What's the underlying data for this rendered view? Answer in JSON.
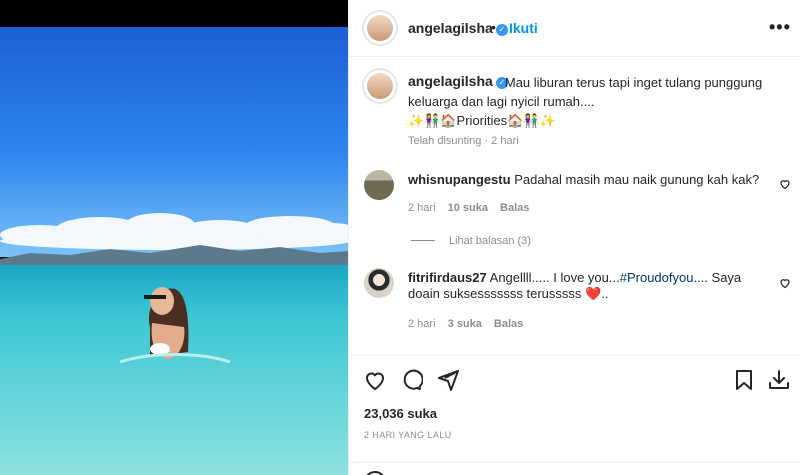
{
  "post": {
    "username": "angelagilsha",
    "follow_label": "Ikuti",
    "more_label": "•••",
    "separator": "•"
  },
  "caption": {
    "username": "angelagilsha",
    "text": "Mau liburan terus tapi inget tulang punggung keluarga dan lagi nyicil rumah....",
    "emoji_line": "✨👫🏠Priorities🏠👫✨",
    "meta": "Telah disunting · 2 hari"
  },
  "comments": [
    {
      "username": "whisnupangestu",
      "text": "Padahal masih mau naik gunung kah kak?",
      "time": "2 hari",
      "likes": "10 suka",
      "reply_label": "Balas",
      "view_replies": "Lihat balasan (3)"
    },
    {
      "username": "fitrifirdaus27",
      "text_before": "Angellll..... I love you...",
      "hashtag": "#Proudofyou",
      "text_after": ".... Saya doain suksesssssss terusssss",
      "heart": "❤️",
      "text_end": "..",
      "time": "2 hari",
      "likes": "3 suka",
      "reply_label": "Balas"
    }
  ],
  "footer": {
    "likes": "23,036 suka",
    "date": "2 HARI YANG LALU"
  },
  "icons": [
    "heart-icon",
    "comment-icon",
    "share-icon",
    "bookmark-icon",
    "download-icon",
    "verified-icon",
    "more-icon",
    "emoji-icon"
  ],
  "colors": {
    "accent": "#0095f6",
    "verified": "#3897f0",
    "muted": "#8e8e8e",
    "text": "#262626"
  }
}
